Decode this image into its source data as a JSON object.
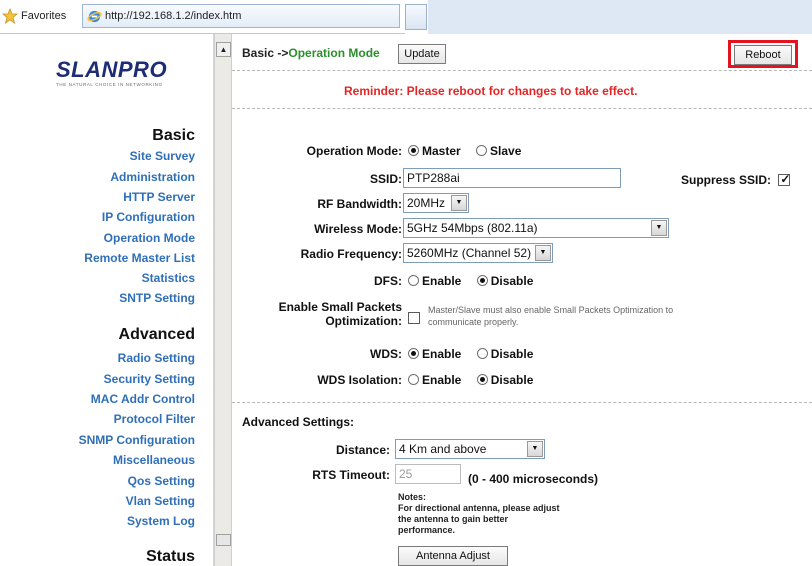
{
  "browser": {
    "favorites_label": "Favorites",
    "url": "http://192.168.1.2/index.htm"
  },
  "logo": {
    "word": "SLANPRO",
    "tagline": "THE NATURAL CHOICE IN NETWORKING"
  },
  "nav": {
    "sections": [
      {
        "title": "Basic",
        "items": [
          "Site Survey",
          "Administration",
          "HTTP Server",
          "IP Configuration",
          "Operation Mode",
          "Remote Master List",
          "Statistics",
          "SNTP Setting"
        ]
      },
      {
        "title": "Advanced",
        "items": [
          "Radio Setting",
          "Security Setting",
          "MAC Addr Control",
          "Protocol Filter",
          "SNMP Configuration",
          "Miscellaneous",
          "Qos Setting",
          "Vlan Setting",
          "System Log"
        ]
      },
      {
        "title": "Status",
        "items": []
      }
    ]
  },
  "page": {
    "crumb_prefix": "Basic ->",
    "crumb_current": "Operation Mode",
    "update_label": "Update",
    "reboot_label": "Reboot",
    "reminder": "Reminder: Please reboot for changes to take effect."
  },
  "form": {
    "operation_mode": {
      "label": "Operation Mode:",
      "options": [
        "Master",
        "Slave"
      ],
      "selected": "Master"
    },
    "ssid": {
      "label": "SSID:",
      "value": "PTP288ai",
      "suppress_label": "Suppress SSID:",
      "suppress_checked": true
    },
    "rf_bandwidth": {
      "label": "RF Bandwidth:",
      "value": "20MHz"
    },
    "wireless_mode": {
      "label": "Wireless Mode:",
      "value": "5GHz 54Mbps (802.11a)"
    },
    "radio_frequency": {
      "label": "Radio Frequency:",
      "value": "5260MHz (Channel 52)"
    },
    "dfs": {
      "label": "DFS:",
      "options": [
        "Enable",
        "Disable"
      ],
      "selected": "Disable"
    },
    "small_packets": {
      "label_line1": "Enable Small Packets",
      "label_line2": "Optimization:",
      "checked": false,
      "note_line1": "Master/Slave must also enable Small Packets Optimization to",
      "note_line2": "communicate properly."
    },
    "wds": {
      "label": "WDS:",
      "options": [
        "Enable",
        "Disable"
      ],
      "selected": "Enable"
    },
    "wds_isolation": {
      "label": "WDS Isolation:",
      "options": [
        "Enable",
        "Disable"
      ],
      "selected": "Disable"
    }
  },
  "advanced": {
    "heading": "Advanced Settings:",
    "distance": {
      "label": "Distance:",
      "value": "4 Km and above"
    },
    "rts_timeout": {
      "label": "RTS Timeout:",
      "value": "25",
      "hint": "(0 - 400 microseconds)"
    },
    "notes": [
      "Notes:",
      "For directional antenna, please adjust",
      "the antenna to gain better",
      "performance."
    ],
    "antenna_adjust_label": "Antenna Adjust"
  },
  "colors": {
    "nav_link": "#2f6fb7",
    "crumb_current": "#2b8f2a",
    "reminder": "#e32525",
    "reboot_highlight": "#e3141f"
  }
}
